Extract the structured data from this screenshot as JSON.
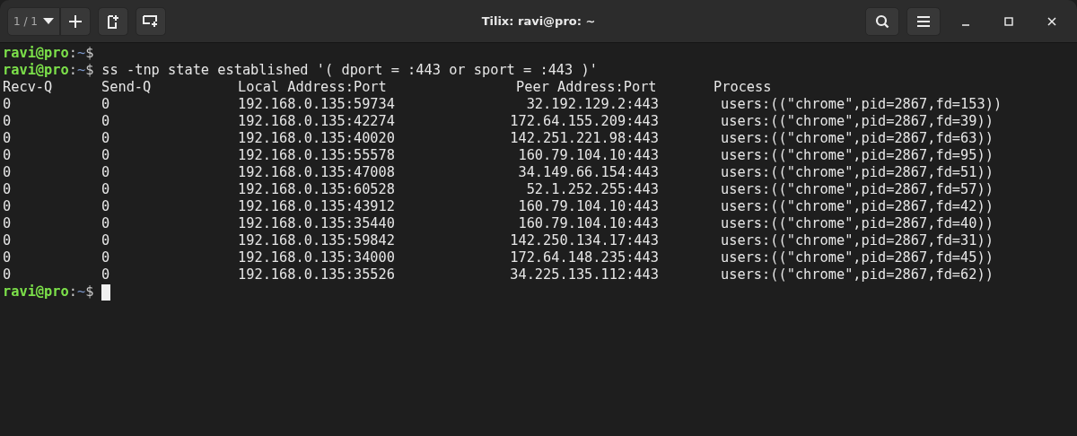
{
  "window": {
    "title": "Tilix: ravi@pro: ~",
    "session_counter": "1 / 1"
  },
  "terminal": {
    "first_prompt": {
      "user": "ravi@pro",
      "separator": ":",
      "path": "~",
      "symbol": "$"
    },
    "command_line": {
      "prompt": {
        "user": "ravi@pro",
        "separator": ":",
        "path": "~",
        "symbol": "$"
      },
      "command": "ss -tnp state established '( dport = :443 or sport = :443 )'"
    },
    "last_prompt": {
      "user": "ravi@pro",
      "separator": ":",
      "path": "~",
      "symbol": "$"
    },
    "columns": [
      "Recv-Q",
      "Send-Q",
      "Local Address:Port",
      "Peer Address:Port",
      "Process"
    ],
    "rows": [
      [
        "0",
        "0",
        "192.168.0.135:59734",
        "32.192.129.2:443",
        "users:((\"chrome\",pid=2867,fd=153))"
      ],
      [
        "0",
        "0",
        "192.168.0.135:42274",
        "172.64.155.209:443",
        "users:((\"chrome\",pid=2867,fd=39))"
      ],
      [
        "0",
        "0",
        "192.168.0.135:40020",
        "142.251.221.98:443",
        "users:((\"chrome\",pid=2867,fd=63))"
      ],
      [
        "0",
        "0",
        "192.168.0.135:55578",
        "160.79.104.10:443",
        "users:((\"chrome\",pid=2867,fd=95))"
      ],
      [
        "0",
        "0",
        "192.168.0.135:47008",
        "34.149.66.154:443",
        "users:((\"chrome\",pid=2867,fd=51))"
      ],
      [
        "0",
        "0",
        "192.168.0.135:60528",
        "52.1.252.255:443",
        "users:((\"chrome\",pid=2867,fd=57))"
      ],
      [
        "0",
        "0",
        "192.168.0.135:43912",
        "160.79.104.10:443",
        "users:((\"chrome\",pid=2867,fd=42))"
      ],
      [
        "0",
        "0",
        "192.168.0.135:35440",
        "160.79.104.10:443",
        "users:((\"chrome\",pid=2867,fd=40))"
      ],
      [
        "0",
        "0",
        "192.168.0.135:59842",
        "142.250.134.17:443",
        "users:((\"chrome\",pid=2867,fd=31))"
      ],
      [
        "0",
        "0",
        "192.168.0.135:34000",
        "172.64.148.235:443",
        "users:((\"chrome\",pid=2867,fd=45))"
      ],
      [
        "0",
        "0",
        "192.168.0.135:35526",
        "34.225.135.112:443",
        "users:((\"chrome\",pid=2867,fd=62))"
      ]
    ]
  }
}
